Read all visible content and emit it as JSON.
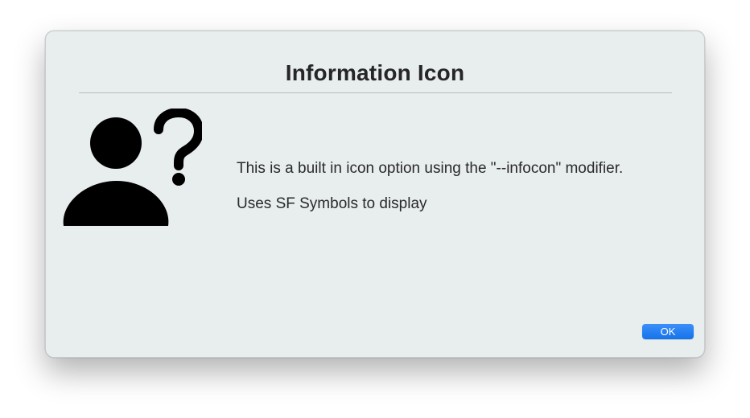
{
  "dialog": {
    "title": "Information Icon",
    "icon": "person-question-icon",
    "message_lines": [
      "This is a built in icon option using the \"--infocon\" modifier.",
      "Uses SF Symbols to display"
    ],
    "ok_label": "OK"
  },
  "colors": {
    "dialog_background": "#e8edee",
    "button_accent": "#1a78f0",
    "text": "#262626"
  }
}
